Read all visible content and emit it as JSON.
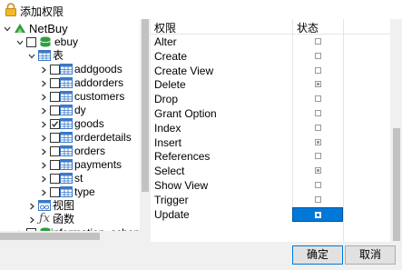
{
  "window": {
    "title": "添加权限"
  },
  "tree": {
    "connection": "NetBuy",
    "database": "ebuy",
    "tables_node": "表",
    "tables": [
      {
        "name": "addgoods",
        "checked": false
      },
      {
        "name": "addorders",
        "checked": false
      },
      {
        "name": "customers",
        "checked": false
      },
      {
        "name": "dy",
        "checked": false
      },
      {
        "name": "goods",
        "checked": true
      },
      {
        "name": "orderdetails",
        "checked": false
      },
      {
        "name": "orders",
        "checked": false
      },
      {
        "name": "payments",
        "checked": false
      },
      {
        "name": "st",
        "checked": false
      },
      {
        "name": "type",
        "checked": false
      }
    ],
    "views_node": "视图",
    "functions_node": "函数",
    "other_database": "information_schema"
  },
  "permissions": {
    "header_privilege": "权限",
    "header_status": "状态",
    "rows": [
      {
        "name": "Alter",
        "checked": false,
        "selected": false
      },
      {
        "name": "Create",
        "checked": false,
        "selected": false
      },
      {
        "name": "Create View",
        "checked": false,
        "selected": false
      },
      {
        "name": "Delete",
        "checked": true,
        "selected": false
      },
      {
        "name": "Drop",
        "checked": false,
        "selected": false
      },
      {
        "name": "Grant Option",
        "checked": false,
        "selected": false
      },
      {
        "name": "Index",
        "checked": false,
        "selected": false
      },
      {
        "name": "Insert",
        "checked": true,
        "selected": false
      },
      {
        "name": "References",
        "checked": false,
        "selected": false
      },
      {
        "name": "Select",
        "checked": true,
        "selected": false
      },
      {
        "name": "Show View",
        "checked": false,
        "selected": false
      },
      {
        "name": "Trigger",
        "checked": false,
        "selected": false
      },
      {
        "name": "Update",
        "checked": true,
        "selected": true
      }
    ]
  },
  "buttons": {
    "ok": "确定",
    "cancel": "取消"
  },
  "colors": {
    "accent": "#0078d7",
    "connection_icon": "#2e9e3e",
    "db_icon": "#2e9e3e",
    "table_icon": "#3c78c8"
  }
}
